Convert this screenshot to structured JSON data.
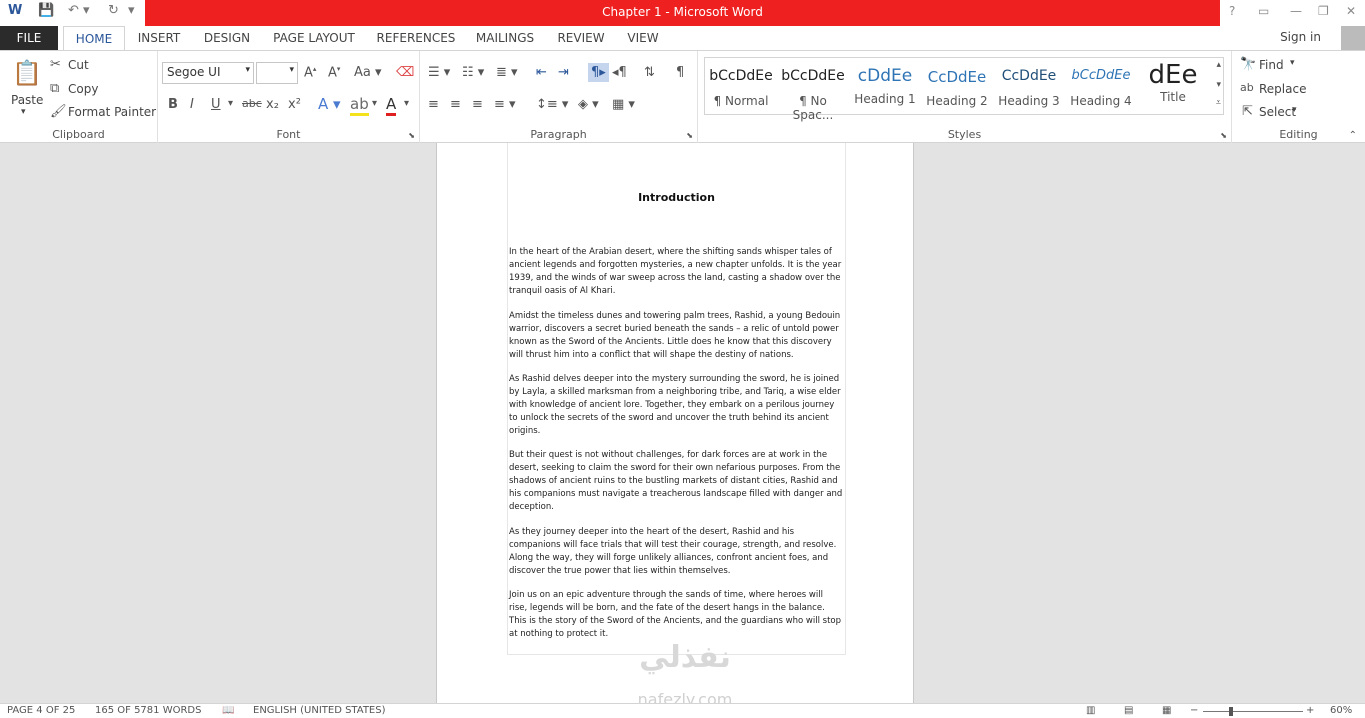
{
  "window": {
    "title": "Chapter 1 -  Microsoft Word"
  },
  "qat": {
    "word_icon": "word-icon",
    "save_icon": "save-icon",
    "undo_icon": "undo-icon",
    "redo_icon": "redo-icon"
  },
  "tabs": [
    "FILE",
    "HOME",
    "INSERT",
    "DESIGN",
    "PAGE LAYOUT",
    "REFERENCES",
    "MAILINGS",
    "REVIEW",
    "VIEW"
  ],
  "account": {
    "signin": "Sign in"
  },
  "clipboard": {
    "paste": "Paste",
    "cut": "Cut",
    "copy": "Copy",
    "format_painter": "Format Painter",
    "label": "Clipboard"
  },
  "font": {
    "name": "Segoe UI",
    "size": "",
    "bold": "B",
    "italic": "I",
    "underline": "U",
    "strike": "abc",
    "sub": "x₂",
    "sup": "x²",
    "label": "Font"
  },
  "paragraph": {
    "label": "Paragraph"
  },
  "styles": {
    "label": "Styles",
    "items": [
      {
        "preview": "bCcDdEe",
        "name": "¶ Normal"
      },
      {
        "preview": "bCcDdEe",
        "name": "¶ No Spac..."
      },
      {
        "preview": "cDdEe",
        "name": "Heading 1"
      },
      {
        "preview": "CcDdEe",
        "name": "Heading 2"
      },
      {
        "preview": "CcDdEe",
        "name": "Heading 3"
      },
      {
        "preview": "bCcDdEe",
        "name": "Heading 4"
      },
      {
        "preview": "dEe",
        "name": "Title"
      }
    ]
  },
  "editing": {
    "find": "Find",
    "replace": "Replace",
    "select": "Select",
    "label": "Editing"
  },
  "document": {
    "heading": "Introduction",
    "paragraphs": [
      "In the heart of the Arabian desert, where the shifting sands whisper tales of ancient legends and forgotten mysteries, a new chapter unfolds. It is the year 1939, and the winds of war sweep across the land, casting a shadow over the tranquil oasis of Al Khari.",
      "Amidst the timeless dunes and towering palm trees, Rashid, a young Bedouin warrior, discovers a secret buried beneath the sands – a relic of untold power known as the Sword of the Ancients. Little does he know that this discovery will thrust him into a conflict that will  shape the destiny of  nations.",
      "As Rashid delves deeper into the mystery surrounding the sword, he is joined by Layla, a  skilled  marksman from a neighboring tribe, and Tariq, a wise elder with  knowledge of ancient lore. Together, they embark on a perilous journey to unlock the secrets of the sword and uncover the truth behind its ancient origins.",
      "But their quest is not without challenges, for dark forces are at work in the desert, seeking to claim the sword for their own nefarious purposes. From the shadows of ancient ruins to the bustling markets of distant cities,  Rashid and his companions must navigate a treacherous landscape filled with danger and deception.",
      "As they journey deeper into the heart of the desert, Rashid and his companions will face trials that will  test their courage, strength, and resolve. Along the way, they will forge unlikely alliances, confront ancient foes, and discover the true power that lies within themselves.",
      "Join us on an epic adventure through the sands of time, where heroes will rise, legends will  be born, and the fate of the desert hangs in the balance. This is the story of the Sword of the Ancients, and the guardians who will stop at nothing to protect it."
    ]
  },
  "status": {
    "page": "PAGE 4 OF 25",
    "words": "165 OF 5781 WORDS",
    "language": "ENGLISH (UNITED STATES)",
    "zoom": "60%"
  },
  "watermark": {
    "arabic": "نفذلي",
    "latin": "nafezly.com"
  }
}
